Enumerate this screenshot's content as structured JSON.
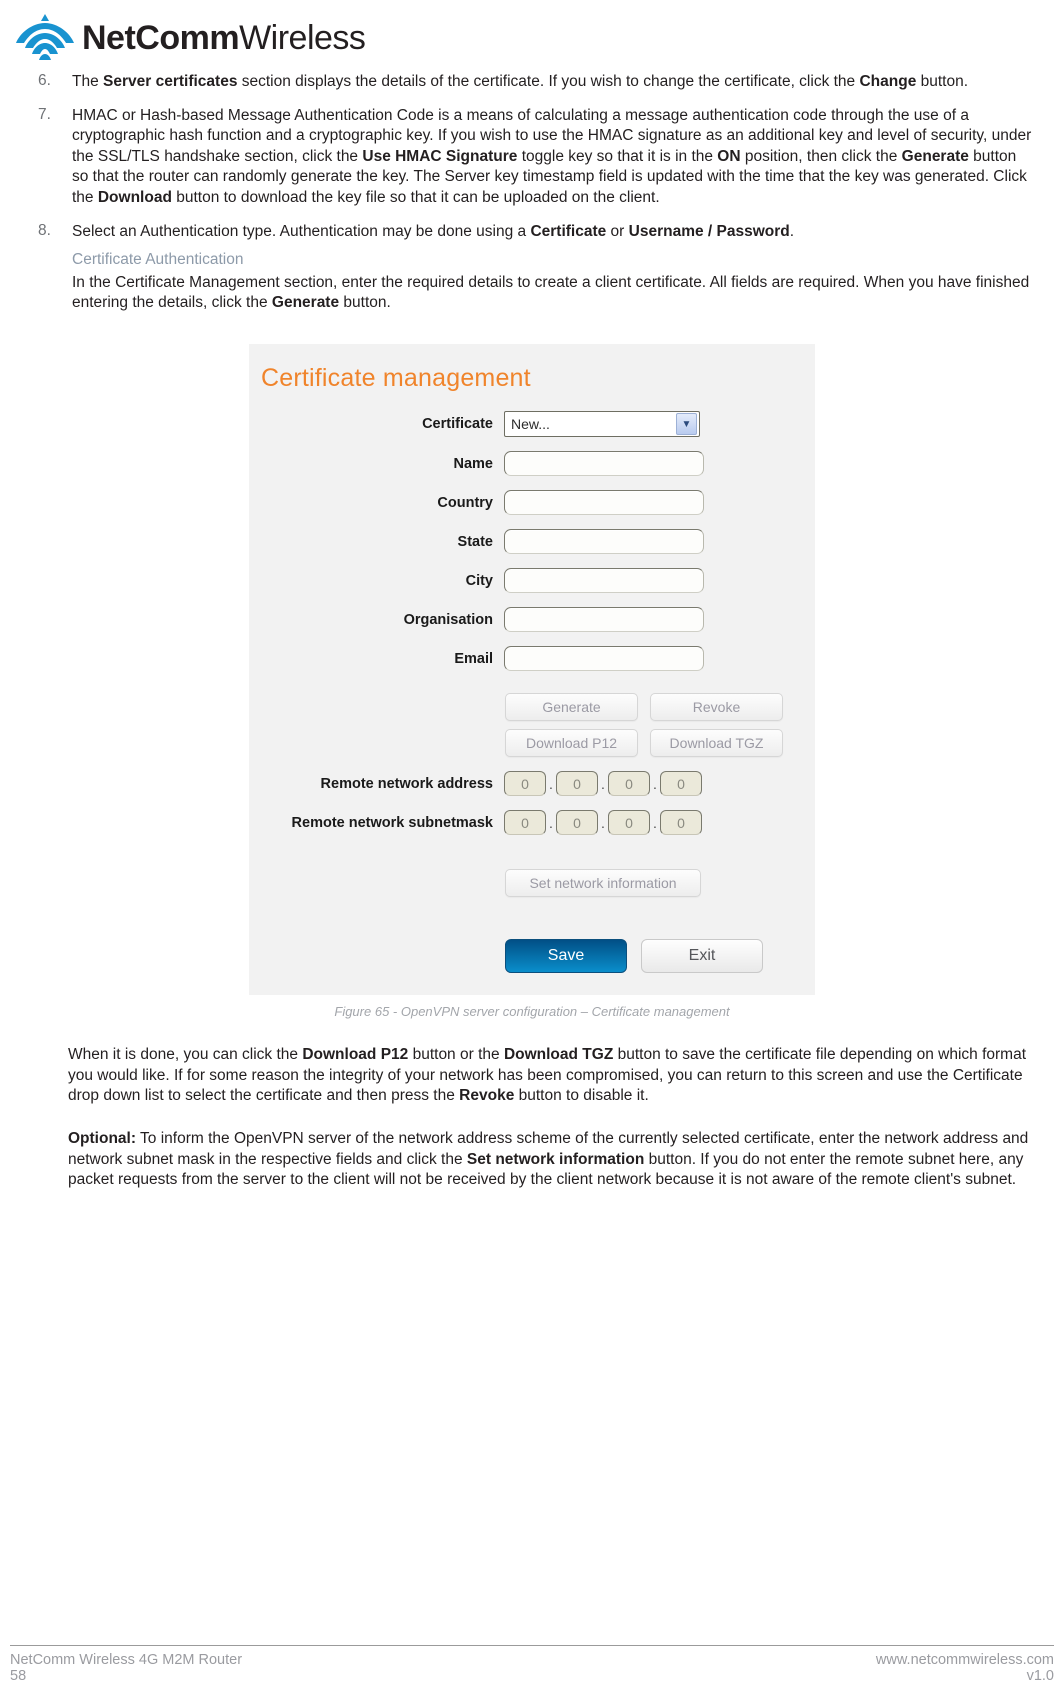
{
  "brand": {
    "name_bold": "NetComm",
    "name_light": "Wireless",
    "logo_icon": "netcomm-signal-logo",
    "logo_color": "#1993d0"
  },
  "steps": [
    {
      "number": "6.",
      "html_parts": [
        {
          "t": "The ",
          "b": false
        },
        {
          "t": "Server certificates",
          "b": true
        },
        {
          "t": " section displays the details of the certificate. If you wish to change the certificate, click the ",
          "b": false
        },
        {
          "t": "Change",
          "b": true
        },
        {
          "t": " button.",
          "b": false
        }
      ]
    },
    {
      "number": "7.",
      "html_parts": [
        {
          "t": "HMAC or Hash-based Message Authentication Code is a means of calculating a message authentication code through the use of a cryptographic hash function and a cryptographic key. If you wish to use the HMAC signature as an additional key and level of security, under the SSL/TLS handshake section, click the ",
          "b": false
        },
        {
          "t": "Use HMAC Signature",
          "b": true
        },
        {
          "t": " toggle key so that it is in the ",
          "b": false
        },
        {
          "t": "ON",
          "b": true
        },
        {
          "t": " position, then click the ",
          "b": false
        },
        {
          "t": "Generate",
          "b": true
        },
        {
          "t": " button so that the router can randomly generate the key. The Server key timestamp field is updated with the time that the key was generated. Click the ",
          "b": false
        },
        {
          "t": "Download",
          "b": true
        },
        {
          "t": " button to download the key file so that it can be uploaded on the client.",
          "b": false
        }
      ]
    },
    {
      "number": "8.",
      "html_parts": [
        {
          "t": "Select an Authentication type. Authentication may be done using a ",
          "b": false
        },
        {
          "t": "Certificate",
          "b": true
        },
        {
          "t": " or ",
          "b": false
        },
        {
          "t": "Username / Password",
          "b": true
        },
        {
          "t": ".",
          "b": false
        }
      ]
    }
  ],
  "subsection": {
    "heading": "Certificate Authentication",
    "heading_color": "#8d9aa9",
    "paragraph_parts": [
      {
        "t": "In the Certificate Management section, enter the required details to create a client certificate. All fields are required. When you have finished entering the details, click the ",
        "b": false
      },
      {
        "t": "Generate",
        "b": true
      },
      {
        "t": " button.",
        "b": false
      }
    ]
  },
  "figure": {
    "caption": "Figure 65 - OpenVPN server configuration – Certificate management",
    "ui": {
      "title": "Certificate management",
      "title_color": "#f0842b",
      "certificate_select": {
        "label": "Certificate",
        "value": "New...",
        "arrow_icon": "chevron-down-icon"
      },
      "text_fields": [
        {
          "label": "Name",
          "value": "",
          "placeholder": ""
        },
        {
          "label": "Country",
          "value": "",
          "placeholder": ""
        },
        {
          "label": "State",
          "value": "",
          "placeholder": ""
        },
        {
          "label": "City",
          "value": "",
          "placeholder": ""
        },
        {
          "label": "Organisation",
          "value": "",
          "placeholder": ""
        },
        {
          "label": "Email",
          "value": "",
          "placeholder": ""
        }
      ],
      "action_buttons_row1": [
        {
          "label": "Generate"
        },
        {
          "label": "Revoke"
        }
      ],
      "action_buttons_row2": [
        {
          "label": "Download P12"
        },
        {
          "label": "Download TGZ"
        }
      ],
      "network_rows": [
        {
          "label": "Remote network address",
          "octets": [
            "0",
            "0",
            "0",
            "0"
          ]
        },
        {
          "label": "Remote network subnetmask",
          "octets": [
            "0",
            "0",
            "0",
            "0"
          ]
        }
      ],
      "set_network_button": "Set network information",
      "save_button": "Save",
      "exit_button": "Exit",
      "save_color": "#0a8ecb"
    }
  },
  "after_paragraphs": [
    {
      "parts": [
        {
          "t": "When it is done, you can click the ",
          "b": false
        },
        {
          "t": "Download P12",
          "b": true
        },
        {
          "t": " button or the ",
          "b": false
        },
        {
          "t": "Download TGZ",
          "b": true
        },
        {
          "t": " button to save the certificate file depending on which format you would like. If for some reason the integrity of your network has been compromised, you can return to this screen and use the Certificate drop down list to select the certificate and then press the ",
          "b": false
        },
        {
          "t": "Revoke",
          "b": true
        },
        {
          "t": " button to disable it.",
          "b": false
        }
      ]
    },
    {
      "parts": [
        {
          "t": "Optional:",
          "b": true
        },
        {
          "t": " To inform the OpenVPN server of the network address scheme of the currently selected certificate, enter the network address and network subnet mask in the respective fields and click the ",
          "b": false
        },
        {
          "t": "Set network information",
          "b": true
        },
        {
          "t": " button. If you do not enter the remote subnet here, any packet requests from the server to the client will not be received by the client network because it is not aware of the remote client's subnet.",
          "b": false
        }
      ]
    }
  ],
  "footer": {
    "product": "NetComm Wireless 4G M2M Router",
    "page_number": "58",
    "website": "www.netcommwireless.com",
    "version": "v1.0"
  }
}
